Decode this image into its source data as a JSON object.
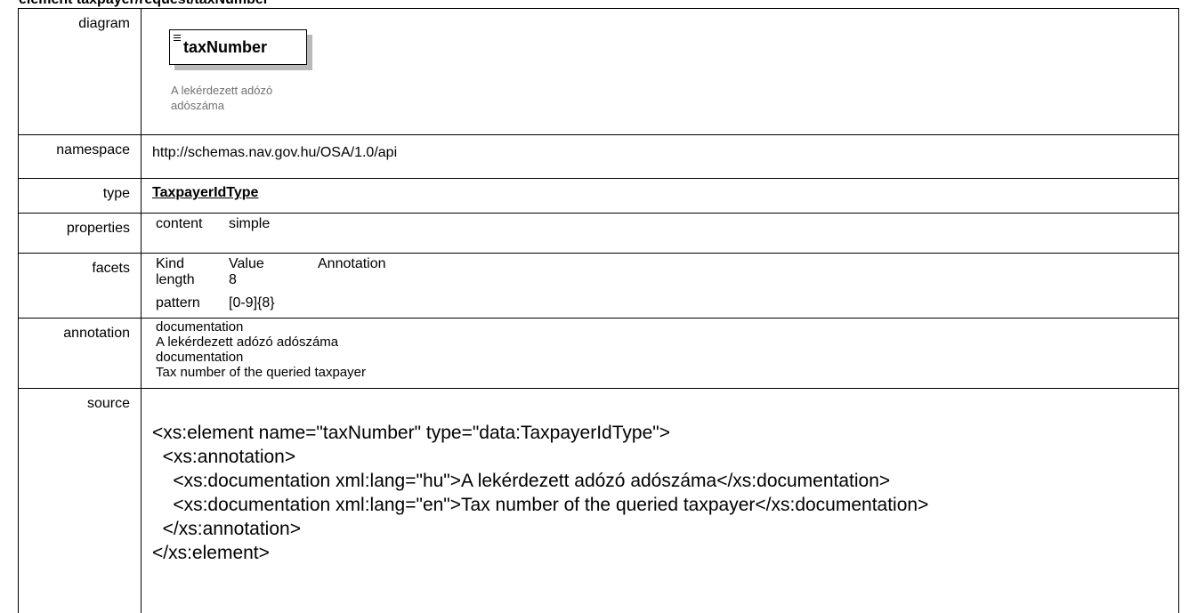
{
  "heading": "element  taxpayer/request/taxNumber",
  "rows": {
    "diagram": {
      "label": "diagram",
      "element_name": "taxNumber",
      "doc_line1": "A lekérdezett adózó",
      "doc_line2": "adószáma"
    },
    "namespace": {
      "label": "namespace",
      "value": "http://schemas.nav.gov.hu/OSA/1.0/api"
    },
    "type": {
      "label": "type",
      "value": "TaxpayerIdType"
    },
    "properties": {
      "label": "properties",
      "key": "content",
      "value": "simple"
    },
    "facets": {
      "label": "facets",
      "headers": [
        "Kind",
        "Value",
        "Annotation"
      ],
      "items": [
        {
          "kind": "length",
          "value": "8"
        },
        {
          "kind": "pattern",
          "value": "[0-9]{8}"
        }
      ]
    },
    "annotation": {
      "label": "annotation",
      "entries": [
        {
          "title": "documentation",
          "text": "A lekérdezett adózó adószáma"
        },
        {
          "title": "documentation",
          "text": "Tax number of the queried taxpayer"
        }
      ]
    },
    "source": {
      "label": "source",
      "lines": [
        "<xs:element name=\"taxNumber\" type=\"data:TaxpayerIdType\">",
        "  <xs:annotation>",
        "    <xs:documentation xml:lang=\"hu\">A lekérdezett adózó adószáma</xs:documentation>",
        "    <xs:documentation xml:lang=\"en\">Tax number of the queried taxpayer</xs:documentation>",
        "  </xs:annotation>",
        "</xs:element>"
      ]
    }
  }
}
